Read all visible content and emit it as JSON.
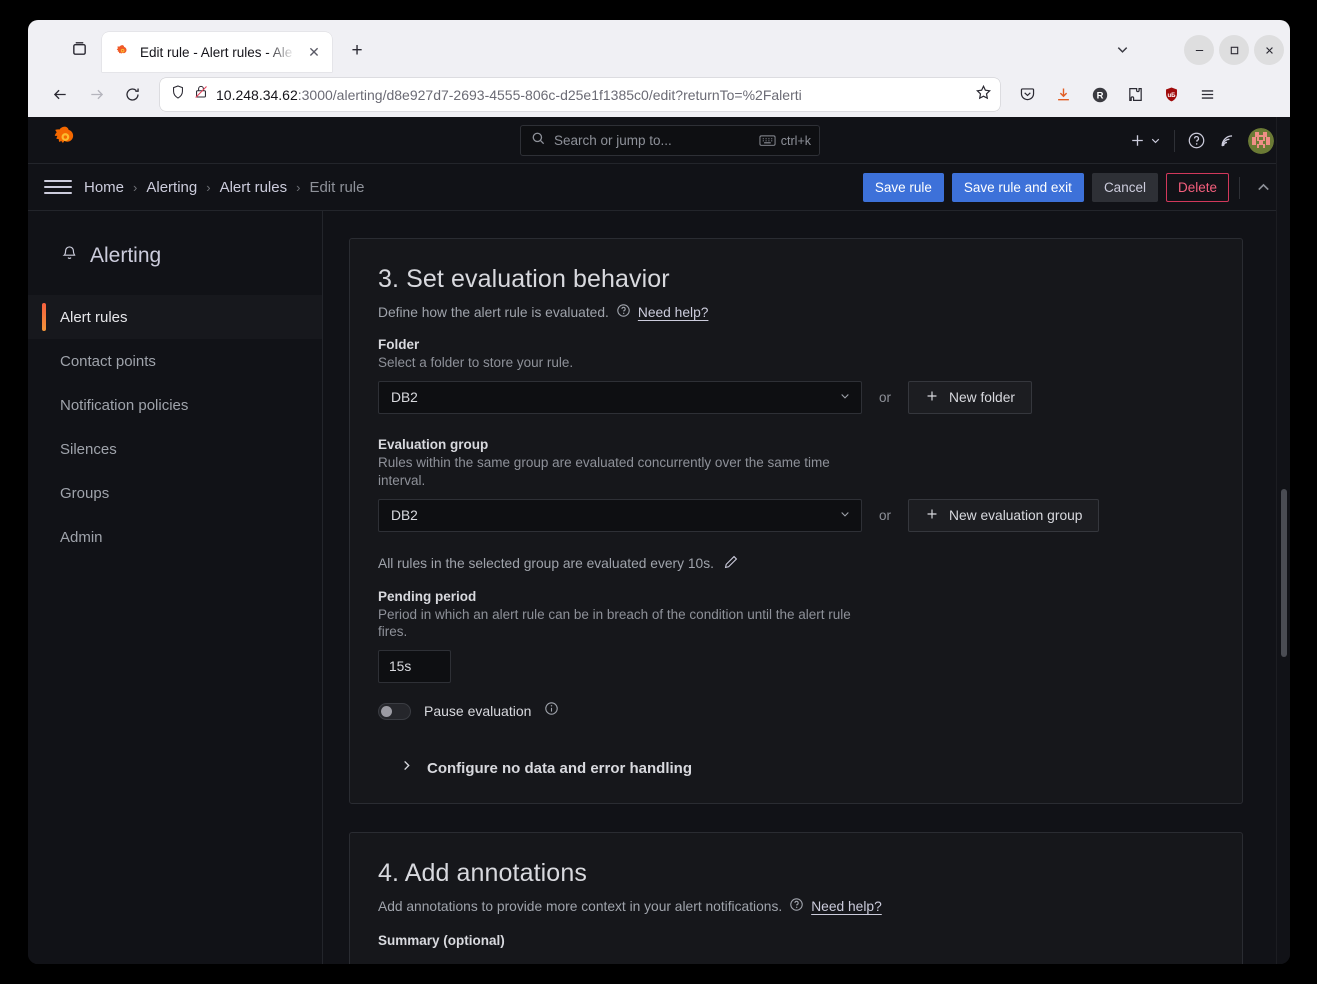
{
  "browser": {
    "tab": {
      "title": "Edit rule - Alert rules - Ale",
      "favicon_name": "grafana-favicon",
      "close_label": "✕"
    },
    "new_tab_label": "+",
    "url": {
      "host": "10.248.34.62",
      "rest": ":3000/alerting/d8e927d7-2693-4555-806c-d25e1f1385c0/edit?returnTo=%2Falerti",
      "full": "10.248.34.62:3000/alerting/d8e927d7-2693-4555-806c-d25e1f1385c0/edit?returnTo=%2Falerti"
    },
    "window_controls": {
      "minimize": "–",
      "maximize": "□",
      "close": "✕"
    },
    "toolbar_icons": [
      "bookmark-star-icon",
      "pocket-icon",
      "downloads-icon",
      "container-account-icon",
      "extensions-icon",
      "ublock-origin-icon",
      "app-menu-icon"
    ]
  },
  "topnav": {
    "logo_name": "grafana-logo",
    "search": {
      "placeholder": "Search or jump to...",
      "shortcut": "ctrl+k"
    },
    "right_icons": [
      "plus-icon",
      "chevron-down-icon",
      "help-circle-icon",
      "news-rss-icon",
      "user-avatar"
    ]
  },
  "breadcrumb": {
    "items": [
      {
        "label": "Home",
        "current": false
      },
      {
        "label": "Alerting",
        "current": false
      },
      {
        "label": "Alert rules",
        "current": false
      },
      {
        "label": "Edit rule",
        "current": true
      }
    ],
    "separator": "›"
  },
  "actions": {
    "save": "Save rule",
    "save_and_exit": "Save rule and exit",
    "cancel": "Cancel",
    "delete": "Delete",
    "collapse_icon": "chevron-up-icon"
  },
  "sidebar": {
    "title": "Alerting",
    "icon": "bell-icon",
    "items": [
      {
        "label": "Alert rules",
        "active": true
      },
      {
        "label": "Contact points",
        "active": false
      },
      {
        "label": "Notification policies",
        "active": false
      },
      {
        "label": "Silences",
        "active": false
      },
      {
        "label": "Groups",
        "active": false
      },
      {
        "label": "Admin",
        "active": false
      }
    ]
  },
  "evaluation_section": {
    "title": "3. Set evaluation behavior",
    "description": "Define how the alert rule is evaluated.",
    "help_link": "Need help?",
    "folder": {
      "label": "Folder",
      "description": "Select a folder to store your rule.",
      "value": "DB2",
      "new_button": "New folder"
    },
    "evaluation_group": {
      "label": "Evaluation group",
      "description": "Rules within the same group are evaluated concurrently over the same time interval.",
      "value": "DB2",
      "new_button": "New evaluation group"
    },
    "or_text": "or",
    "interval_note": "All rules in the selected group are evaluated every 10s.",
    "pending_period": {
      "label": "Pending period",
      "description": "Period in which an alert rule can be in breach of the condition until the alert rule fires.",
      "value": "15s"
    },
    "pause_evaluation": {
      "label": "Pause evaluation",
      "enabled": false
    },
    "collapse_section": "Configure no data and error handling"
  },
  "annotations_section": {
    "title": "4. Add annotations",
    "description": "Add annotations to provide more context in your alert notifications.",
    "help_link": "Need help?",
    "summary_label": "Summary (optional)"
  },
  "colors": {
    "accent_blue": "#3d71d9",
    "danger_pink": "#f55f7d",
    "grafana_orange": "#f55f3e",
    "page_bg": "#111217",
    "card_bg": "#16171b"
  }
}
